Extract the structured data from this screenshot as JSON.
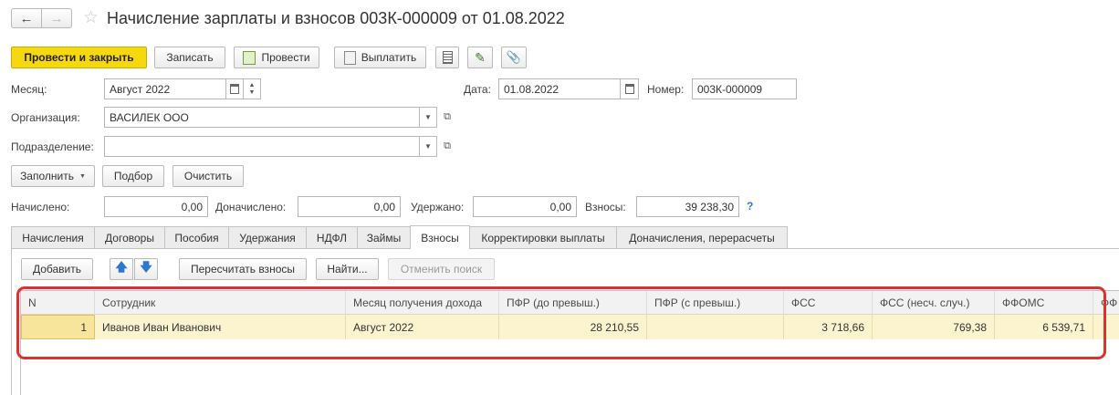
{
  "window": {
    "title": "Начисление зарплаты и взносов 003К-000009 от 01.08.2022"
  },
  "toolbar": {
    "post_and_close": "Провести и закрыть",
    "save": "Записать",
    "post": "Провести",
    "pay": "Выплатить"
  },
  "form": {
    "month_label": "Месяц:",
    "month_value": "Август 2022",
    "date_label": "Дата:",
    "date_value": "01.08.2022",
    "number_label": "Номер:",
    "number_value": "003К-000009",
    "org_label": "Организация:",
    "org_value": "ВАСИЛЕК ООО",
    "dept_label": "Подразделение:",
    "dept_value": ""
  },
  "actions": {
    "fill": "Заполнить",
    "select": "Подбор",
    "clear": "Очистить"
  },
  "totals": {
    "accrued_label": "Начислено:",
    "accrued_value": "0,00",
    "additional_label": "Доначислено:",
    "additional_value": "0,00",
    "withheld_label": "Удержано:",
    "withheld_value": "0,00",
    "contrib_label": "Взносы:",
    "contrib_value": "39 238,30",
    "help": "?"
  },
  "tabs": [
    "Начисления",
    "Договоры",
    "Пособия",
    "Удержания",
    "НДФЛ",
    "Займы",
    "Взносы",
    "Корректировки выплаты",
    "Доначисления, перерасчеты"
  ],
  "table_toolbar": {
    "add": "Добавить",
    "recalc": "Пересчитать взносы",
    "find": "Найти...",
    "cancel_search": "Отменить поиск"
  },
  "table": {
    "columns": [
      "N",
      "Сотрудник",
      "Месяц получения дохода",
      "ПФР (до превыш.)",
      "ПФР (с превыш.)",
      "ФСС",
      "ФСС (несч. случ.)",
      "ФФОМС",
      "ФФ"
    ],
    "rows": [
      {
        "n": "1",
        "employee": "Иванов Иван Иванович",
        "month": "Август 2022",
        "pfr_to": "28 210,55",
        "pfr_over": "",
        "fss": "3 718,66",
        "fss_acc": "769,38",
        "ffoms": "6 539,71"
      }
    ]
  },
  "colors": {
    "primary_button": "#f6d80f",
    "selected_row": "#fcf3cf",
    "highlight_border": "#d9322f"
  }
}
